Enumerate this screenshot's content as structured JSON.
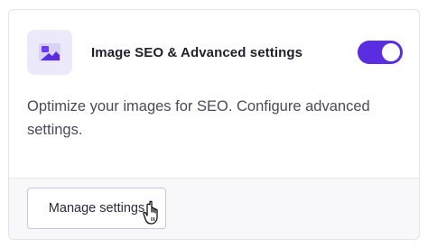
{
  "card": {
    "title": "Image SEO & Advanced settings",
    "description": "Optimize your images for SEO. Configure advanced settings.",
    "icon": "image-icon",
    "toggle": {
      "state": "on",
      "color": "#5a2ee0"
    }
  },
  "footer": {
    "manage_button_label": "Manage settings"
  },
  "colors": {
    "accent": "#5a2ee0",
    "icon_bg": "#ece9fb"
  }
}
